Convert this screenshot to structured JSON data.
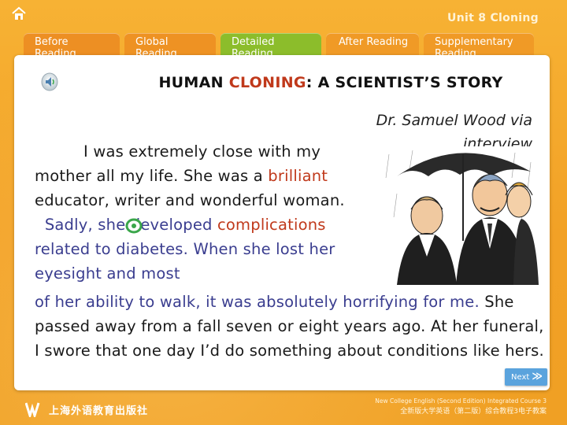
{
  "header": {
    "unit_title": "Unit 8 Cloning",
    "tabs": [
      {
        "label": "Before Reading"
      },
      {
        "label": "Global Reading"
      },
      {
        "label": "Detailed Reading"
      },
      {
        "label": "After Reading"
      },
      {
        "label": "Supplementary Reading"
      }
    ]
  },
  "content": {
    "title_part1": "HUMAN ",
    "title_highlight": "CLONING",
    "title_part2": ": A SCIENTIST’S STORY",
    "byline": "Dr. Samuel Wood via interview",
    "para_seg1": "I was extremely close with my mother all my life. She was a ",
    "para_seg2": "brilliant",
    "para_seg3": " educator, writer and wonderful woman.",
    "para_seg4": "Sadly, she developed ",
    "para_seg5": "complications",
    "para_seg6": " related to diabetes. When she lost her eyesight and most",
    "para2_seg1": "of her ability to walk, it was absolutely horrifying for me.",
    "para2_seg2": " She passed away from a fall seven or eight years ago. At her funeral, I swore that one day I’d do something about conditions like hers."
  },
  "nav": {
    "next_label": "Next",
    "next_arrow": "≫"
  },
  "footer": {
    "publisher": "上海外语教育出版社",
    "course_en": "New College English (Second Edition) Integrated Course 3",
    "course_cn": "全新版大学英语（第二版）综合教程3电子教案"
  },
  "colors": {
    "background": "#f2a126",
    "highlight_red": "#c0391b",
    "highlight_blue": "#3a3d8f",
    "active_tab": "#8cbd2b",
    "next_button": "#5aa3dd"
  },
  "icons": [
    "home-icon",
    "speaker-icon",
    "note-icon",
    "publisher-logo-icon"
  ]
}
